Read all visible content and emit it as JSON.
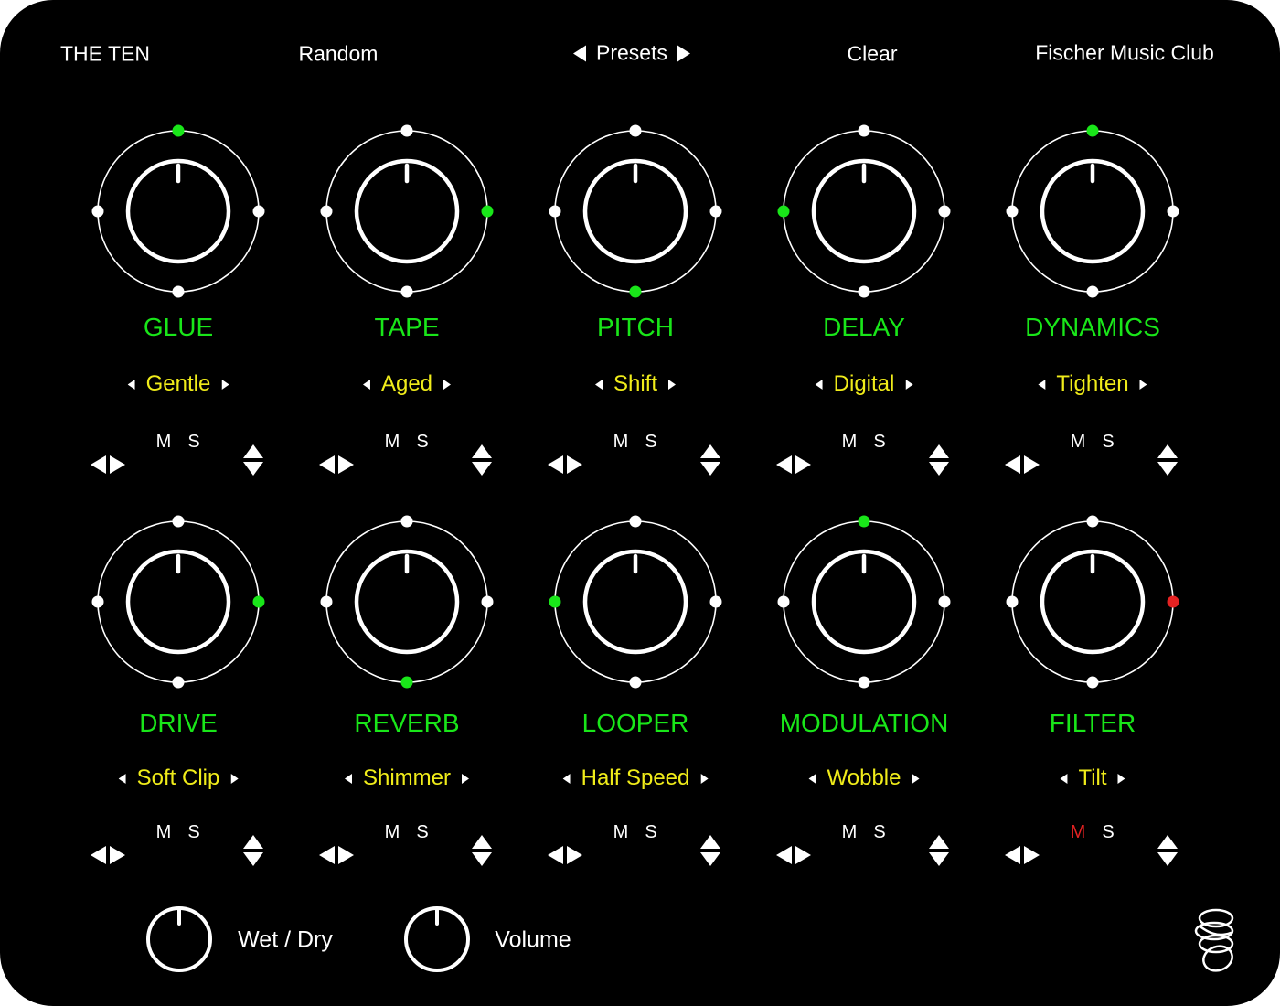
{
  "header": {
    "title": "THE TEN",
    "random_label": "Random",
    "presets_label": "Presets",
    "clear_label": "Clear",
    "brand": "Fischer Music Club"
  },
  "colors": {
    "background": "#000000",
    "foreground": "#ffffff",
    "accent_green": "#19e619",
    "preset_yellow": "#f0ec1a",
    "alert_red": "#e52222"
  },
  "modules": [
    {
      "name": "GLUE",
      "preset": "Gentle",
      "position": "top",
      "mute_label": "M",
      "solo_label": "S",
      "mute_active": false
    },
    {
      "name": "TAPE",
      "preset": "Aged",
      "position": "right",
      "mute_label": "M",
      "solo_label": "S",
      "mute_active": false
    },
    {
      "name": "PITCH",
      "preset": "Shift",
      "position": "bottom",
      "mute_label": "M",
      "solo_label": "S",
      "mute_active": false
    },
    {
      "name": "DELAY",
      "preset": "Digital",
      "position": "left",
      "mute_label": "M",
      "solo_label": "S",
      "mute_active": false
    },
    {
      "name": "DYNAMICS",
      "preset": "Tighten",
      "position": "top",
      "mute_label": "M",
      "solo_label": "S",
      "mute_active": false
    },
    {
      "name": "DRIVE",
      "preset": "Soft Clip",
      "position": "right",
      "mute_label": "M",
      "solo_label": "S",
      "mute_active": false
    },
    {
      "name": "REVERB",
      "preset": "Shimmer",
      "position": "bottom",
      "mute_label": "M",
      "solo_label": "S",
      "mute_active": false
    },
    {
      "name": "LOOPER",
      "preset": "Half Speed",
      "position": "left",
      "mute_label": "M",
      "solo_label": "S",
      "mute_active": false
    },
    {
      "name": "MODULATION",
      "preset": "Wobble",
      "position": "top",
      "mute_label": "M",
      "solo_label": "S",
      "mute_active": false
    },
    {
      "name": "FILTER",
      "preset": "Tilt",
      "position": "right",
      "mute_label": "M",
      "solo_label": "S",
      "mute_active": true
    }
  ],
  "footer": {
    "wet_dry_label": "Wet / Dry",
    "volume_label": "Volume"
  },
  "icons": {
    "logo": "scribble-logo-icon",
    "knob": "knob-icon",
    "preset_arrows": "triangle-left-right-icon",
    "reorder": "arrow-left-right-icon",
    "updown": "arrow-up-down-icon"
  }
}
